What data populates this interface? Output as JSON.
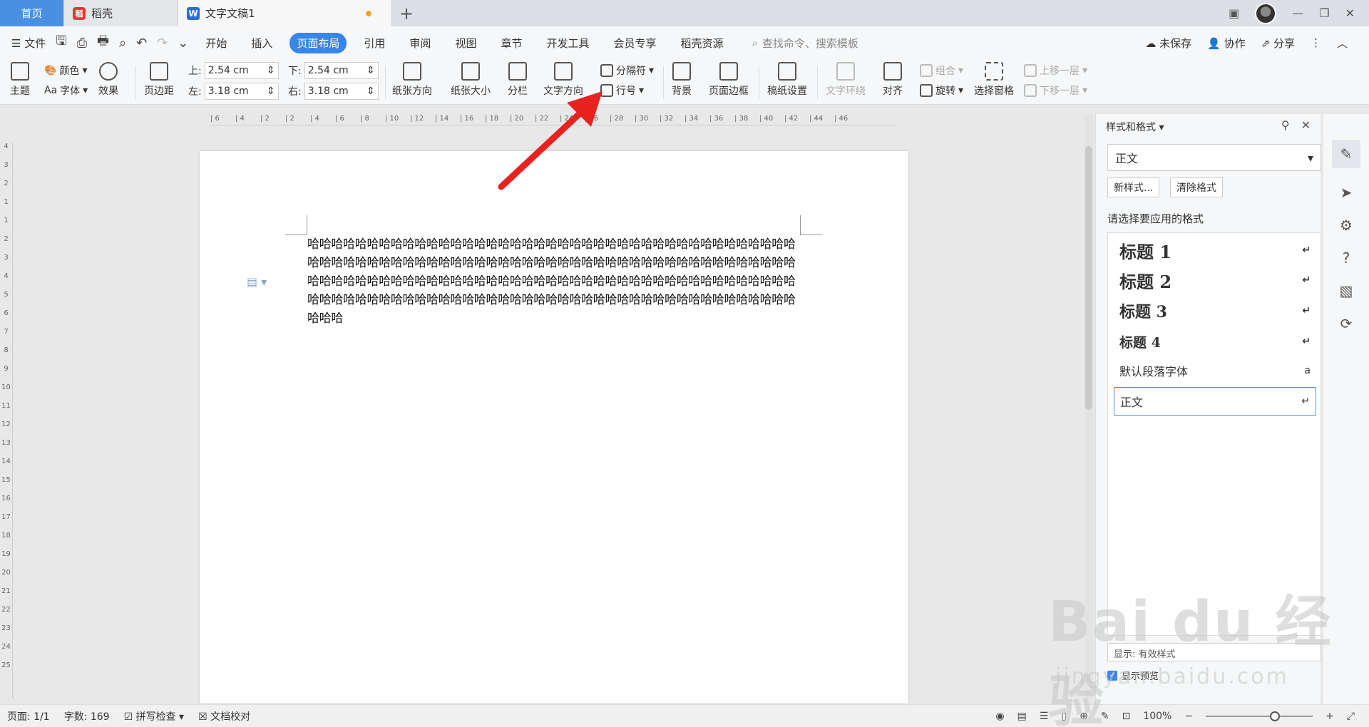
{
  "tabs": {
    "home": "首页",
    "daoke": "稻壳",
    "doc": "文字文稿1",
    "add": "+"
  },
  "menubar": {
    "file": "文件",
    "items": [
      "开始",
      "插入",
      "页面布局",
      "引用",
      "审阅",
      "视图",
      "章节",
      "开发工具",
      "会员专享",
      "稻壳资源"
    ],
    "active": "页面布局",
    "search": "查找命令、搜索模板",
    "unsaved": "未保存",
    "collab": "协作",
    "share": "分享"
  },
  "ribbon": {
    "theme": "主题",
    "color": "颜色",
    "font": "字体",
    "effect": "效果",
    "margin": "页边距",
    "top_label": "上:",
    "top_val": "2.54 cm",
    "bottom_label": "下:",
    "bottom_val": "2.54 cm",
    "left_label": "左:",
    "left_val": "3.18 cm",
    "right_label": "右:",
    "right_val": "3.18 cm",
    "orientation": "纸张方向",
    "size": "纸张大小",
    "columns": "分栏",
    "text_dir": "文字方向",
    "separator": "分隔符",
    "line_no": "行号",
    "background": "背景",
    "border": "页面边框",
    "draft": "稿纸设置",
    "wrap": "文字环绕",
    "align": "对齐",
    "group": "组合",
    "rotate": "旋转",
    "select_pane": "选择窗格",
    "up": "上移一层",
    "down": "下移一层"
  },
  "document": {
    "text": "哈哈哈哈哈哈哈哈哈哈哈哈哈哈哈哈哈哈哈哈哈哈哈哈哈哈哈哈哈哈哈哈哈哈哈哈哈哈哈哈哈哈哈哈哈哈哈哈哈哈哈哈哈哈哈哈哈哈哈哈哈哈哈哈哈哈哈哈哈哈哈哈哈哈哈哈哈哈哈哈哈哈哈哈哈哈哈哈哈哈哈哈哈哈哈哈哈哈哈哈哈哈哈哈哈哈哈哈哈哈哈哈哈哈哈哈哈哈哈哈哈哈哈哈哈哈哈哈哈哈哈哈哈哈哈哈哈哈哈哈哈哈哈哈哈哈哈哈哈哈哈哈哈哈哈哈哈哈哈哈哈哈哈哈哈哈哈"
  },
  "panel": {
    "title": "样式和格式",
    "current": "正文",
    "new_style": "新样式...",
    "clear_format": "清除格式",
    "apply_label": "请选择要应用的格式",
    "styles": [
      "标题  1",
      "标题  2",
      "标题  3",
      "标题  4",
      "默认段落字体",
      "正文"
    ],
    "show": "显示: 有效样式",
    "preview": "显示预览"
  },
  "status": {
    "page": "页面: 1/1",
    "words": "字数: 169",
    "spell": "拼写检查",
    "proof": "文档校对",
    "zoom": "100%"
  },
  "ruler": {
    "h": [
      "6",
      "4",
      "2",
      "2",
      "4",
      "6",
      "8",
      "10",
      "12",
      "14",
      "16",
      "18",
      "20",
      "22",
      "24",
      "26",
      "28",
      "30",
      "32",
      "34",
      "36",
      "38",
      "40",
      "42",
      "44",
      "46"
    ],
    "v": [
      "4",
      "3",
      "2",
      "1",
      "1",
      "2",
      "3",
      "4",
      "5",
      "6",
      "7",
      "8",
      "9",
      "10",
      "11",
      "12",
      "13",
      "14",
      "15",
      "16",
      "17",
      "18",
      "19",
      "20",
      "21",
      "22",
      "23",
      "24",
      "25"
    ]
  },
  "watermark": {
    "brand": "Bai du 经验",
    "url": "jingyan.baidu.com"
  }
}
